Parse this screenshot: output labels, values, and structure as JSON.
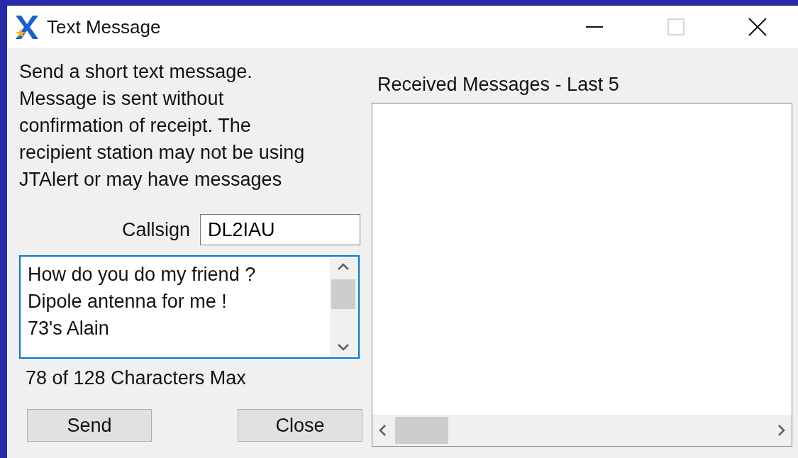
{
  "window": {
    "title": "Text Message"
  },
  "description": "Send a short text message.\nMessage is sent without\nconfirmation of receipt. The\nrecipient station may not be using\nJTAlert or may have messages",
  "callsign": {
    "label": "Callsign",
    "value": "DL2IAU"
  },
  "message": {
    "value": "How do you do my friend ?\nDipole antenna for me !\n73's Alain",
    "focused": true
  },
  "char_count": "78 of 128 Characters Max",
  "buttons": [
    "Send",
    "Close"
  ],
  "received": {
    "label": "Received Messages - Last 5"
  }
}
